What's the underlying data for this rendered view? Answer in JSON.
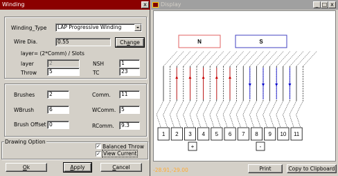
{
  "winding": {
    "title": "Winding",
    "close_glyph": "x",
    "type_label": "Winding_Type",
    "type_value": "LAP Progressive Winding",
    "wire_label": "Wire Dia.",
    "wire_value": "0.55",
    "change_prefix": "Ch",
    "change_accel": "a",
    "change_suffix": "nge",
    "formula": "layer= (2*Comm) / Slots",
    "layer_label": "layer",
    "layer_value": "2",
    "nsh_label": "NSH",
    "nsh_value": "1",
    "throw_label": "Throw",
    "throw_value": "5",
    "tc_label": "TC",
    "tc_value": "23",
    "brushes_label": "Brushes",
    "brushes_value": "2",
    "comm_label": "Comm.",
    "comm_value": "11",
    "wbrush_label": "WBrush",
    "wbrush_value": "6",
    "wcomm_label": "WComm.",
    "wcomm_value": "5",
    "offset_label": "Brush Offset",
    "offset_value": "0",
    "rcomm_label": "RComm.",
    "rcomm_value": "9.3",
    "drawing_label": "Drawing Option",
    "balanced_label": "Balanced Throw",
    "view_label": "View Current",
    "check_glyph": "✓",
    "ok_accel": "O",
    "ok_rest": "k",
    "apply_accel": "A",
    "apply_rest": "pply",
    "cancel_accel": "C",
    "cancel_rest": "ancel"
  },
  "display": {
    "title": "Display",
    "min_glyph": "_",
    "max_glyph": "□",
    "close_glyph": "x",
    "pole_n": "N",
    "pole_s": "S",
    "commutator": [
      "1",
      "2",
      "3",
      "4",
      "5",
      "6",
      "7",
      "8",
      "9",
      "10",
      "11"
    ],
    "brush_plus": "+",
    "brush_minus": "-",
    "coords": "-28.91,-29.00",
    "print_label": "Print",
    "copy_label": "Copy to Clipboard"
  },
  "colors": {
    "titlebar": "#8b0000",
    "pole_n": "#e06060",
    "pole_s": "#4040c0",
    "current_up": "#cc0000",
    "current_down": "#0000cc"
  }
}
